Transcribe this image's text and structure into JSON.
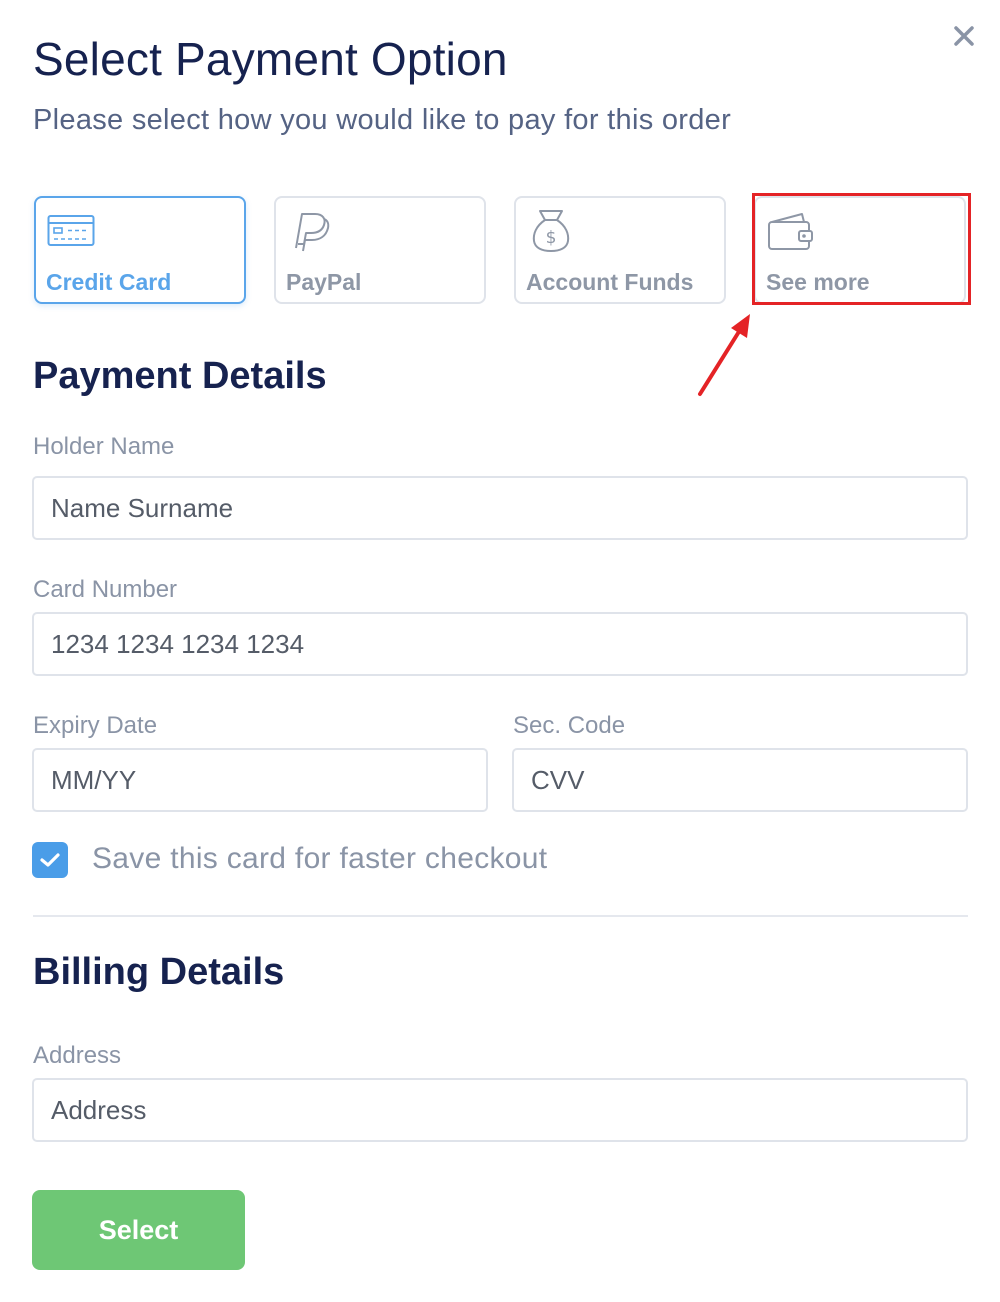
{
  "modal": {
    "title": "Select Payment Option",
    "subtitle": "Please select how you would like to pay for this order"
  },
  "payment_options": [
    {
      "label": "Credit Card",
      "icon": "credit-card-icon",
      "selected": true
    },
    {
      "label": "PayPal",
      "icon": "paypal-icon",
      "selected": false
    },
    {
      "label": "Account Funds",
      "icon": "money-bag-icon",
      "selected": false
    },
    {
      "label": "See more",
      "icon": "wallet-icon",
      "selected": false
    }
  ],
  "payment_details": {
    "heading": "Payment Details",
    "holder_name": {
      "label": "Holder Name",
      "placeholder": "Name Surname",
      "value": ""
    },
    "card_number": {
      "label": "Card Number",
      "placeholder": "1234 1234 1234 1234",
      "value": ""
    },
    "expiry_date": {
      "label": "Expiry Date",
      "placeholder": "MM/YY",
      "value": ""
    },
    "sec_code": {
      "label": "Sec. Code",
      "placeholder": "CVV",
      "value": ""
    },
    "save_card": {
      "label": "Save this card for faster checkout",
      "checked": true
    }
  },
  "billing_details": {
    "heading": "Billing Details",
    "address": {
      "label": "Address",
      "placeholder": "Address",
      "value": ""
    }
  },
  "actions": {
    "select_label": "Select"
  },
  "colors": {
    "accent": "#5aa5ea",
    "heading": "#16224f",
    "muted_text": "#8a94a6",
    "select_button": "#6ec775",
    "highlight_annotation": "#e42326"
  }
}
